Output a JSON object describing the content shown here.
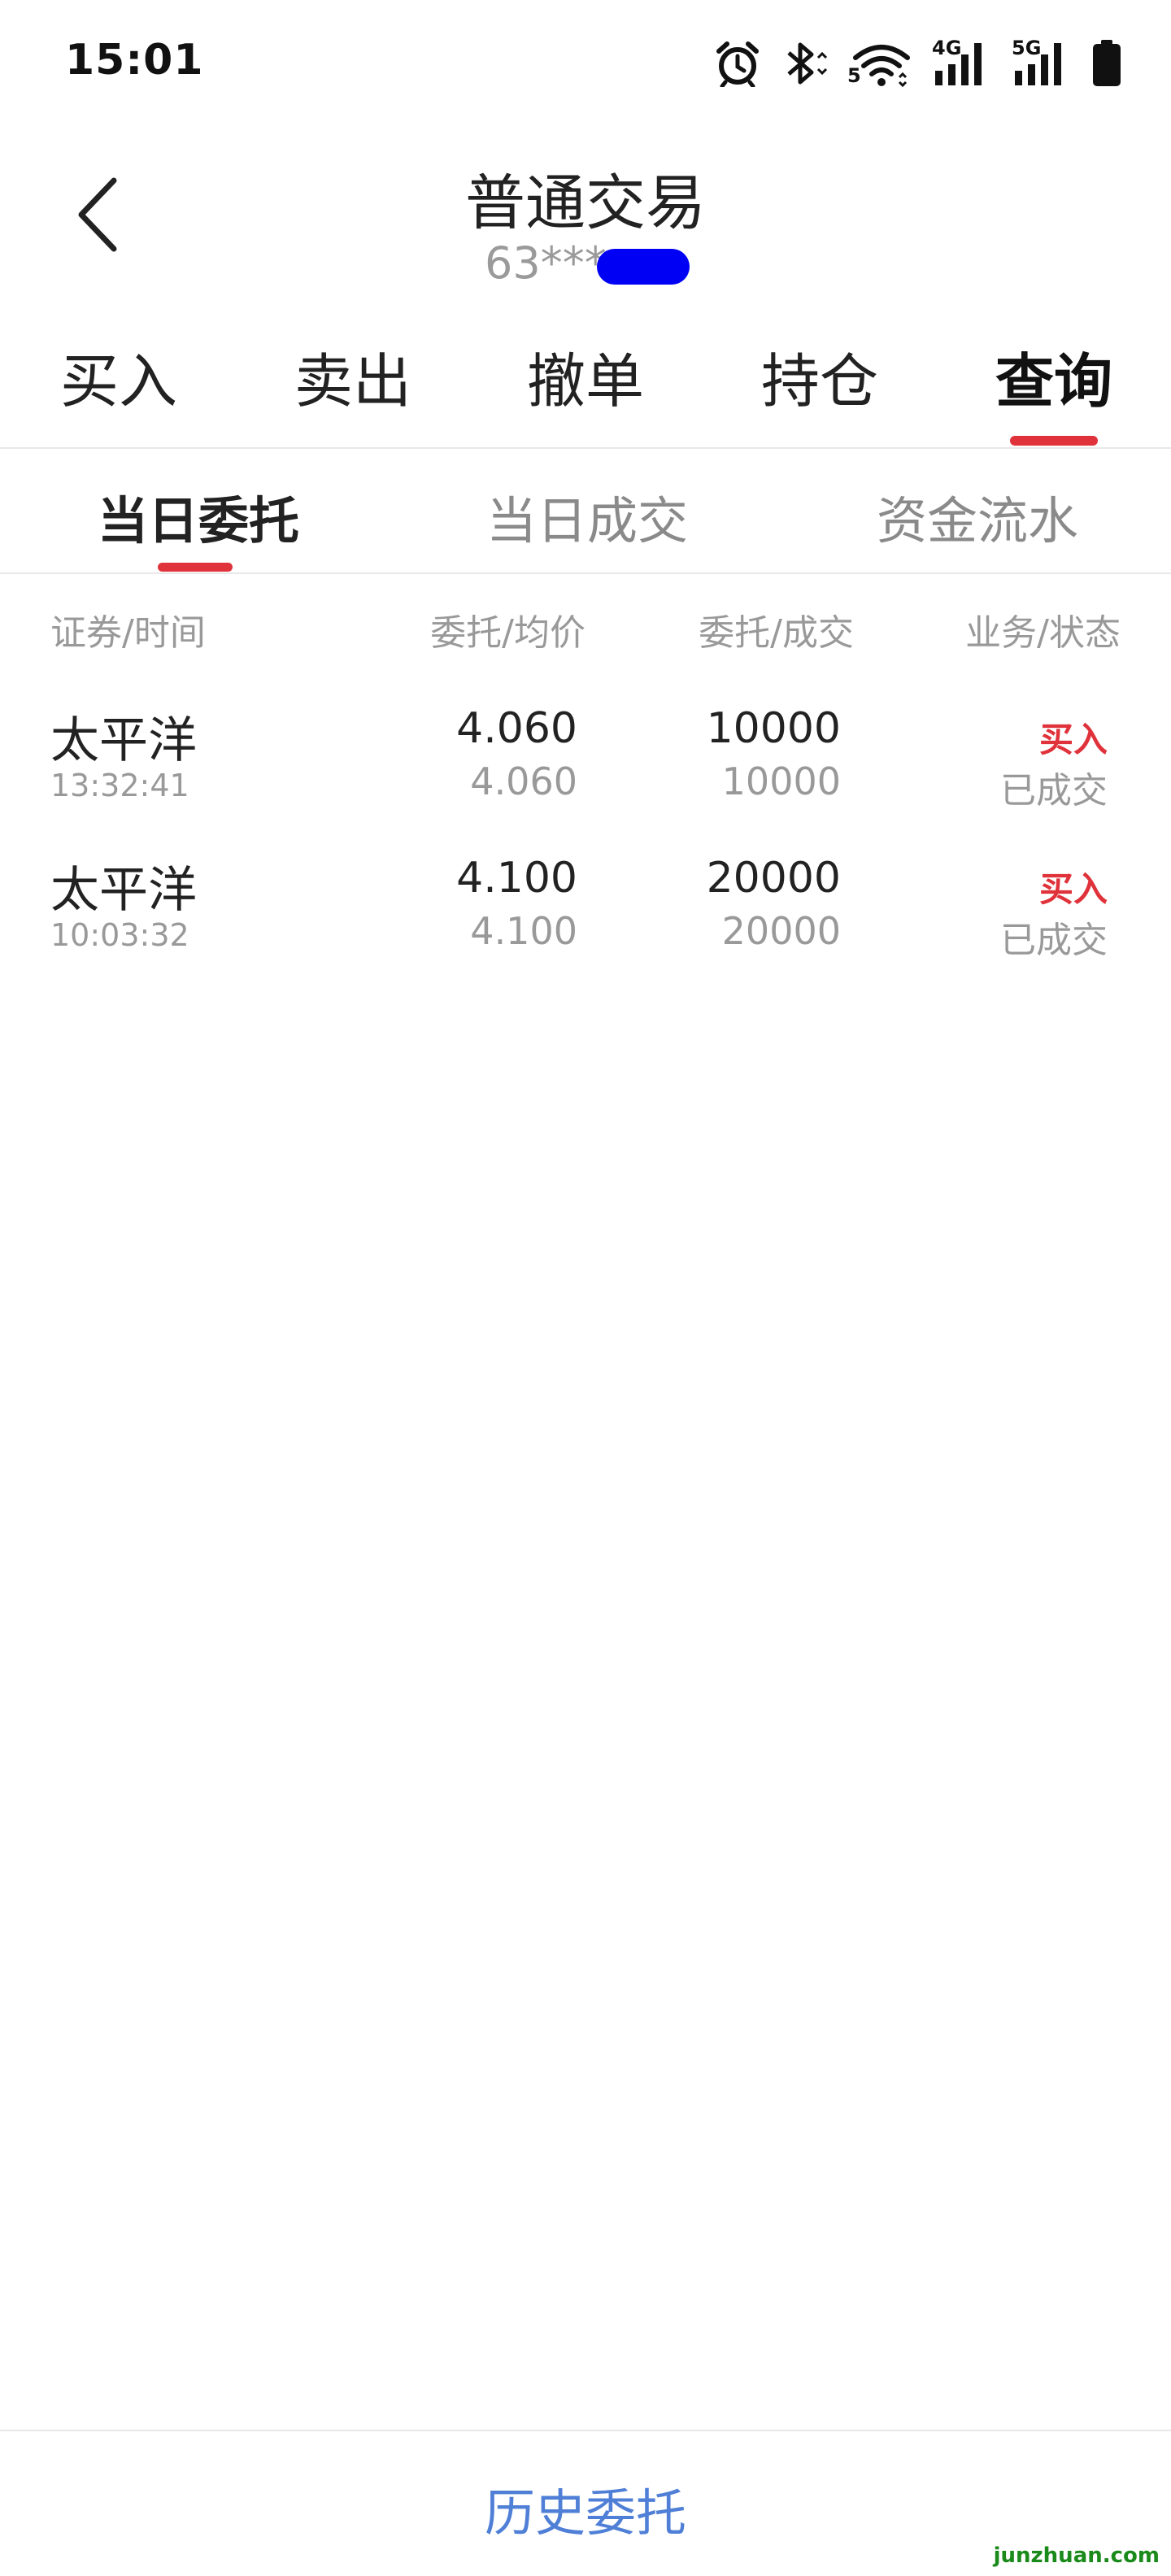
{
  "status_bar": {
    "time": "15:01",
    "icons": [
      "alarm-icon",
      "bluetooth-icon",
      "wifi-icon",
      "signal-4g-icon",
      "signal-5g-icon",
      "battery-icon"
    ],
    "wifi_badge": "5",
    "net1": "4G",
    "net2": "5G"
  },
  "header": {
    "title": "普通交易",
    "account": "63***"
  },
  "main_tabs": [
    "买入",
    "卖出",
    "撤单",
    "持仓",
    "查询"
  ],
  "main_tab_active": "查询",
  "sub_tabs": [
    "当日委托",
    "当日成交",
    "资金流水"
  ],
  "sub_tab_active": "当日委托",
  "table": {
    "headers": [
      "证券/时间",
      "委托/均价",
      "委托/成交",
      "业务/状态"
    ],
    "rows": [
      {
        "name": "太平洋",
        "time": "13:32:41",
        "price": "4.060",
        "avg": "4.060",
        "qty": "10000",
        "filled": "10000",
        "biz": "买入",
        "status": "已成交"
      },
      {
        "name": "太平洋",
        "time": "10:03:32",
        "price": "4.100",
        "avg": "4.100",
        "qty": "20000",
        "filled": "20000",
        "biz": "买入",
        "status": "已成交"
      }
    ]
  },
  "footer": {
    "history_label": "历史委托"
  },
  "watermark": "junzhuan.com",
  "colors": {
    "accent": "#e0323a",
    "link": "#4f7fd6",
    "mask": "#0000f5"
  }
}
